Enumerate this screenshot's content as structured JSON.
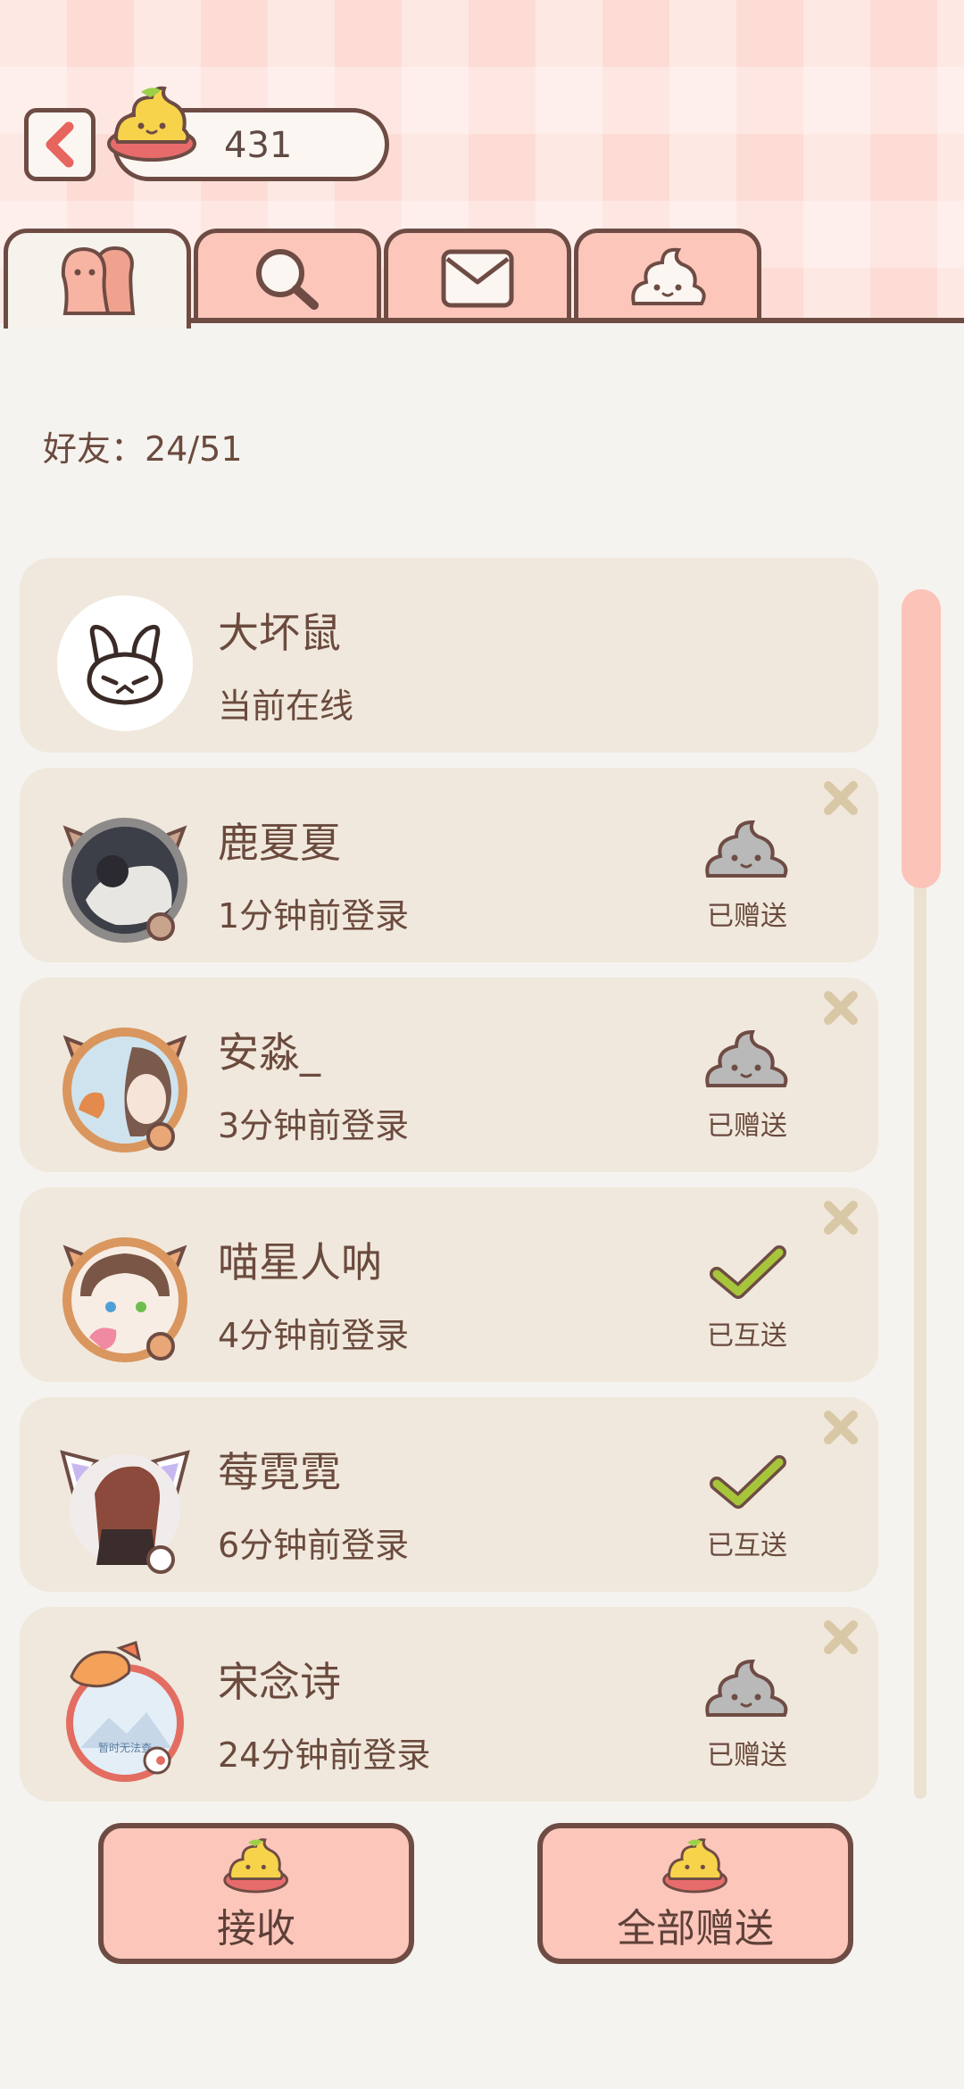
{
  "header": {
    "coins": "431"
  },
  "tabs": [
    {
      "icon": "friends-icon",
      "active": true
    },
    {
      "icon": "search-icon",
      "active": false
    },
    {
      "icon": "mail-icon",
      "active": false
    },
    {
      "icon": "poop-mascot-icon",
      "active": false
    }
  ],
  "friends": {
    "count_label": "好友：24/51",
    "items": [
      {
        "name": "大坏鼠",
        "status": "当前在线",
        "gift": ""
      },
      {
        "name": "鹿夏夏",
        "status": "1分钟前登录",
        "gift": "已赠送"
      },
      {
        "name": "安淼_",
        "status": "3分钟前登录",
        "gift": "已赠送"
      },
      {
        "name": "喵星人呐",
        "status": "4分钟前登录",
        "gift": "已互送"
      },
      {
        "name": "莓霓霓",
        "status": "6分钟前登录",
        "gift": "已互送"
      },
      {
        "name": "宋念诗",
        "status": "24分钟前登录",
        "gift": "已赠送"
      }
    ]
  },
  "avatar_overlay_text": "暂时无法查",
  "actions": {
    "receive_label": "接收",
    "send_all_label": "全部赠送"
  },
  "colors": {
    "header_pink": "#fddcd6",
    "tab_pink": "#fdc6bb",
    "card_bg": "#f0e8dc",
    "outline_brown": "#6e4c44",
    "check_green": "#9bbd35"
  }
}
